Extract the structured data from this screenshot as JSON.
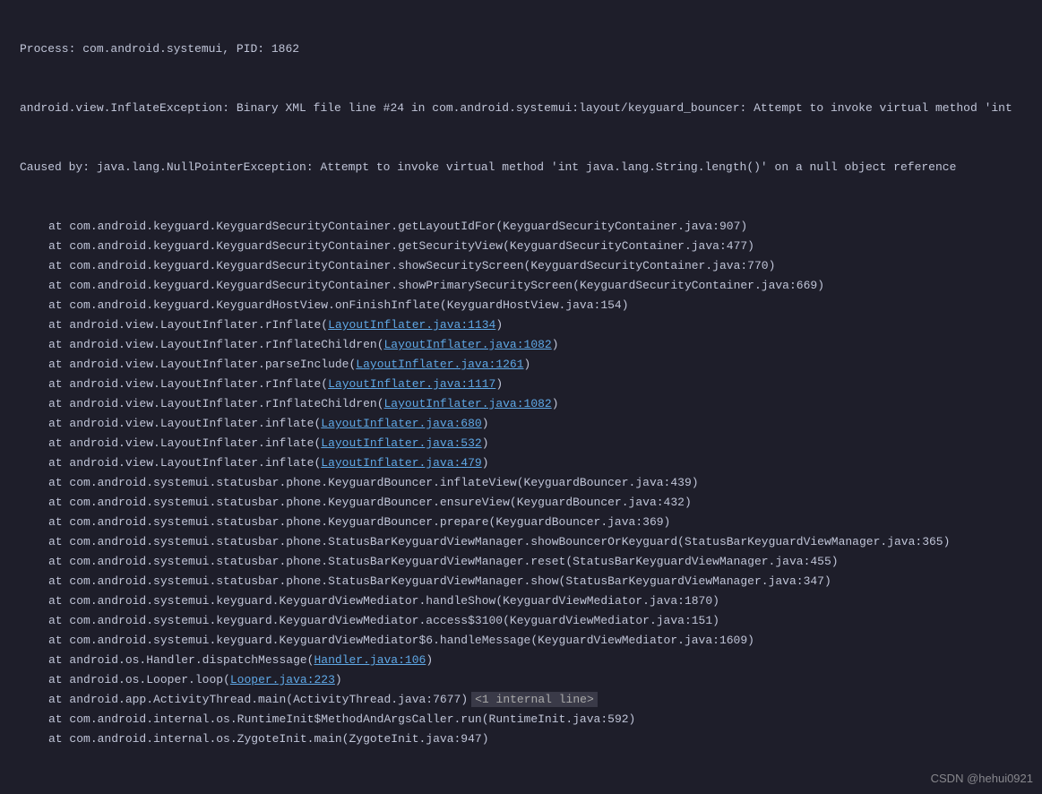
{
  "header": {
    "process_line": "Process: com.android.systemui, PID: 1862",
    "exception_line": "android.view.InflateException: Binary XML file line #24 in com.android.systemui:layout/keyguard_bouncer: Attempt to invoke virtual method 'int",
    "caused_by_line": "Caused by: java.lang.NullPointerException: Attempt to invoke virtual method 'int java.lang.String.length()' on a null object reference"
  },
  "frames": [
    {
      "at": "at",
      "method": "com.android.keyguard.KeyguardSecurityContainer.getLayoutIdFor",
      "loc": "KeyguardSecurityContainer.java:907",
      "link": false
    },
    {
      "at": "at",
      "method": "com.android.keyguard.KeyguardSecurityContainer.getSecurityView",
      "loc": "KeyguardSecurityContainer.java:477",
      "link": false
    },
    {
      "at": "at",
      "method": "com.android.keyguard.KeyguardSecurityContainer.showSecurityScreen",
      "loc": "KeyguardSecurityContainer.java:770",
      "link": false
    },
    {
      "at": "at",
      "method": "com.android.keyguard.KeyguardSecurityContainer.showPrimarySecurityScreen",
      "loc": "KeyguardSecurityContainer.java:669",
      "link": false
    },
    {
      "at": "at",
      "method": "com.android.keyguard.KeyguardHostView.onFinishInflate",
      "loc": "KeyguardHostView.java:154",
      "link": false
    },
    {
      "at": "at",
      "method": "android.view.LayoutInflater.rInflate",
      "loc": "LayoutInflater.java:1134",
      "link": true
    },
    {
      "at": "at",
      "method": "android.view.LayoutInflater.rInflateChildren",
      "loc": "LayoutInflater.java:1082",
      "link": true
    },
    {
      "at": "at",
      "method": "android.view.LayoutInflater.parseInclude",
      "loc": "LayoutInflater.java:1261",
      "link": true
    },
    {
      "at": "at",
      "method": "android.view.LayoutInflater.rInflate",
      "loc": "LayoutInflater.java:1117",
      "link": true
    },
    {
      "at": "at",
      "method": "android.view.LayoutInflater.rInflateChildren",
      "loc": "LayoutInflater.java:1082",
      "link": true
    },
    {
      "at": "at",
      "method": "android.view.LayoutInflater.inflate",
      "loc": "LayoutInflater.java:680",
      "link": true
    },
    {
      "at": "at",
      "method": "android.view.LayoutInflater.inflate",
      "loc": "LayoutInflater.java:532",
      "link": true
    },
    {
      "at": "at",
      "method": "android.view.LayoutInflater.inflate",
      "loc": "LayoutInflater.java:479",
      "link": true
    },
    {
      "at": "at",
      "method": "com.android.systemui.statusbar.phone.KeyguardBouncer.inflateView",
      "loc": "KeyguardBouncer.java:439",
      "link": false
    },
    {
      "at": "at",
      "method": "com.android.systemui.statusbar.phone.KeyguardBouncer.ensureView",
      "loc": "KeyguardBouncer.java:432",
      "link": false
    },
    {
      "at": "at",
      "method": "com.android.systemui.statusbar.phone.KeyguardBouncer.prepare",
      "loc": "KeyguardBouncer.java:369",
      "link": false
    },
    {
      "at": "at",
      "method": "com.android.systemui.statusbar.phone.StatusBarKeyguardViewManager.showBouncerOrKeyguard",
      "loc": "StatusBarKeyguardViewManager.java:365",
      "link": false
    },
    {
      "at": "at",
      "method": "com.android.systemui.statusbar.phone.StatusBarKeyguardViewManager.reset",
      "loc": "StatusBarKeyguardViewManager.java:455",
      "link": false
    },
    {
      "at": "at",
      "method": "com.android.systemui.statusbar.phone.StatusBarKeyguardViewManager.show",
      "loc": "StatusBarKeyguardViewManager.java:347",
      "link": false
    },
    {
      "at": "at",
      "method": "com.android.systemui.keyguard.KeyguardViewMediator.handleShow",
      "loc": "KeyguardViewMediator.java:1870",
      "link": false
    },
    {
      "at": "at",
      "method": "com.android.systemui.keyguard.KeyguardViewMediator.access$3100",
      "loc": "KeyguardViewMediator.java:151",
      "link": false
    },
    {
      "at": "at",
      "method": "com.android.systemui.keyguard.KeyguardViewMediator$6.handleMessage",
      "loc": "KeyguardViewMediator.java:1609",
      "link": false
    },
    {
      "at": "at",
      "method": "android.os.Handler.dispatchMessage",
      "loc": "Handler.java:106",
      "link": true
    },
    {
      "at": "at",
      "method": "android.os.Looper.loop",
      "loc": "Looper.java:223",
      "link": true
    },
    {
      "at": "at",
      "method": "android.app.ActivityThread.main",
      "loc": "ActivityThread.java:7677",
      "link": false,
      "trailer": "<1 internal line>"
    },
    {
      "at": "at",
      "method": "com.android.internal.os.RuntimeInit$MethodAndArgsCaller.run",
      "loc": "RuntimeInit.java:592",
      "link": false
    },
    {
      "at": "at",
      "method": "com.android.internal.os.ZygoteInit.main",
      "loc": "ZygoteInit.java:947",
      "link": false
    }
  ],
  "watermark": "CSDN @hehui0921"
}
